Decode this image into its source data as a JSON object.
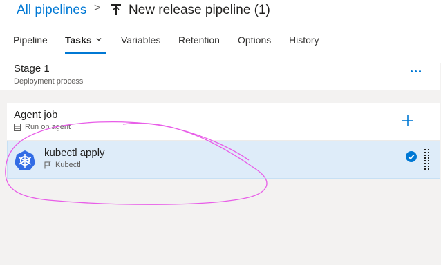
{
  "breadcrumb": {
    "all_pipelines": "All pipelines",
    "separator": ">"
  },
  "pipeline": {
    "title": "New release pipeline (1)",
    "icon": "release-pipeline-icon"
  },
  "tabs": [
    {
      "label": "Pipeline",
      "active": false
    },
    {
      "label": "Tasks",
      "active": true,
      "has_dropdown": true
    },
    {
      "label": "Variables",
      "active": false
    },
    {
      "label": "Retention",
      "active": false
    },
    {
      "label": "Options",
      "active": false
    },
    {
      "label": "History",
      "active": false
    }
  ],
  "stage": {
    "title": "Stage 1",
    "subtitle": "Deployment process",
    "more_icon": "more-icon"
  },
  "agent_job": {
    "title": "Agent job",
    "subtitle": "Run on agent",
    "icon": "server-icon",
    "add_icon": "plus-icon"
  },
  "task": {
    "title": "kubectl apply",
    "subtitle": "Kubectl",
    "icon": "kubernetes-icon",
    "flag_icon": "flag-icon",
    "status_icon": "check-circle-icon"
  },
  "colors": {
    "accent": "#0078d4",
    "selected_row": "#deecf9",
    "kubernetes": "#326ce5",
    "annotation": "#e85de8"
  }
}
